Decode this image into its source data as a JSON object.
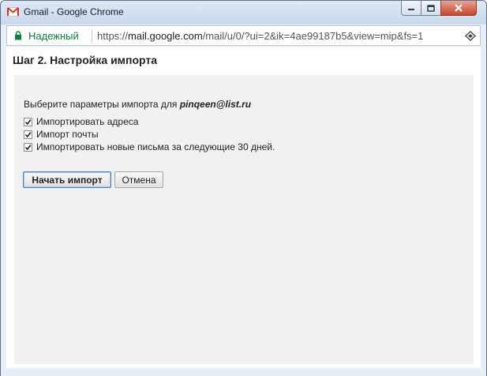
{
  "window": {
    "title": "Gmail - Google Chrome"
  },
  "addressbar": {
    "secure_label": "Надежный",
    "url_scheme": "https://",
    "url_host": "mail.google.com",
    "url_path": "/mail/u/0/?ui=2&ik=4ae99187b5&view=mip&fs=1"
  },
  "page": {
    "title": "Шаг 2. Настройка импорта",
    "prompt_text": "Выберите параметры импорта для ",
    "prompt_email": "pinqeen@list.ru",
    "options": [
      {
        "label": "Импортировать адреса",
        "checked": true
      },
      {
        "label": "Импорт почты",
        "checked": true
      },
      {
        "label": "Импортировать новые письма за следующие 30 дней.",
        "checked": true
      }
    ],
    "start_button": "Начать импорт",
    "cancel_button": "Отмена"
  },
  "icons": {
    "app": "gmail-icon",
    "lock": "lock-icon",
    "extension": "extension-icon"
  },
  "colors": {
    "secure_green": "#0b8043",
    "gmail_red": "#d93025",
    "close_red": "#c7452f"
  }
}
